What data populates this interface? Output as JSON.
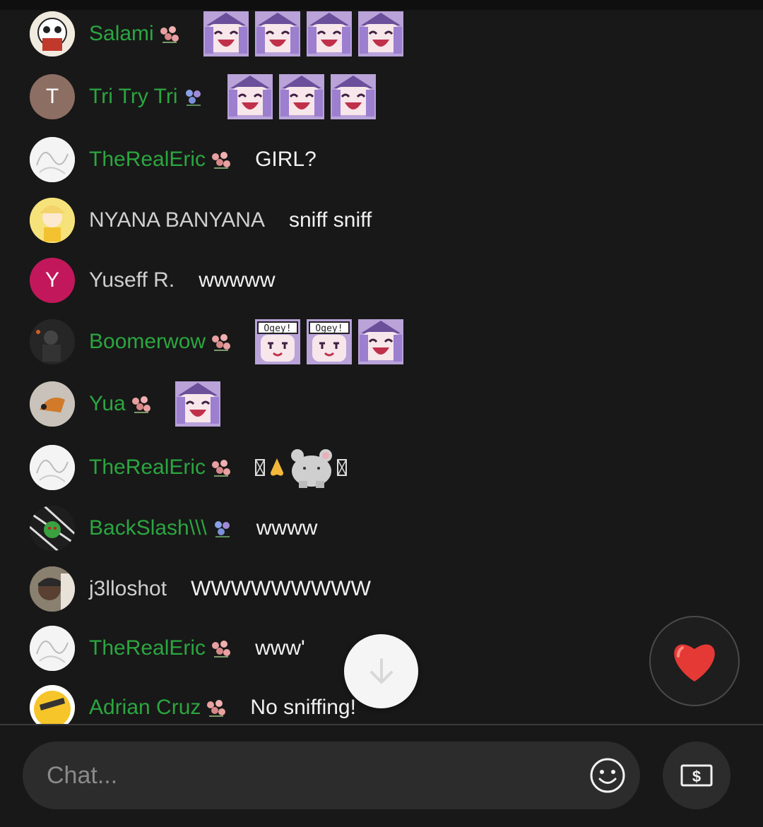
{
  "messages": [
    {
      "author": "Salami",
      "text": ""
    },
    {
      "author": "Tri Try Tri",
      "avatar_letter": "T",
      "avatar_color": "#8d6e63",
      "text": ""
    },
    {
      "author": "TheRealEric",
      "text": "GIRL?"
    },
    {
      "author": "NYANA BANYANA",
      "text": "sniff sniff"
    },
    {
      "author": "Yuseff R.",
      "avatar_letter": "Y",
      "avatar_color": "#c2185b",
      "text": "wwwww"
    },
    {
      "author": "Boomerwow",
      "text": ""
    },
    {
      "author": "Yua",
      "text": ""
    },
    {
      "author": "TheRealEric",
      "text": ""
    },
    {
      "author": "BackSlash\\\\\\",
      "text": "wwww"
    },
    {
      "author": "j3lloshot",
      "text": "WWWWWWWWW"
    },
    {
      "author": "TheRealEric",
      "text": "www'"
    },
    {
      "author": "Adrian Cruz",
      "text": "No sniffing!"
    }
  ],
  "colors": {
    "member_name": "#2ba640",
    "plain_name": "#cfcfcf",
    "background": "#181818"
  },
  "icons": {
    "scroll_down": "arrow-down-icon",
    "heart": "heart-icon",
    "emoji": "smiley-icon",
    "super_chat": "dollar-bill-icon"
  },
  "input": {
    "placeholder": "Chat..."
  }
}
